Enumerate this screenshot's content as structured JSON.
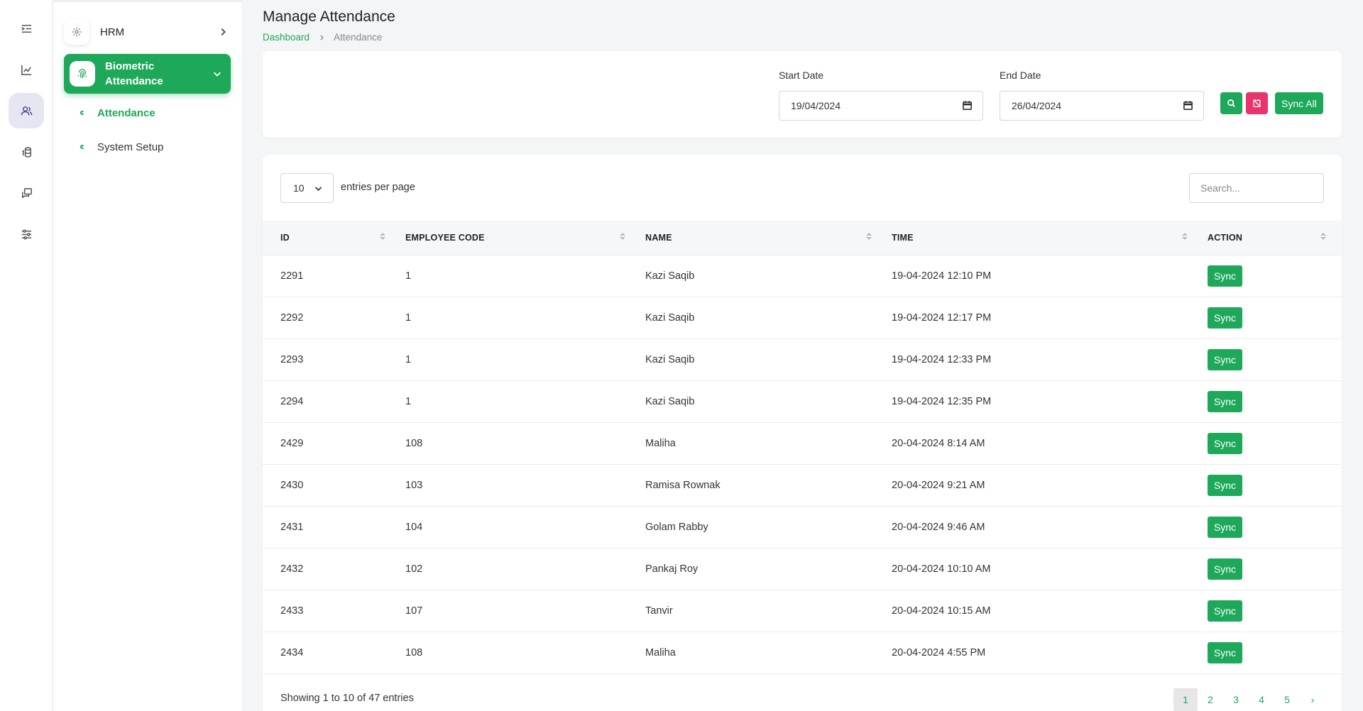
{
  "nav": {
    "hrm_label": "HRM",
    "biometric_label": "Biometric Attendance",
    "sub_items": [
      {
        "label": "Attendance",
        "active": true
      },
      {
        "label": "System Setup",
        "active": false
      }
    ]
  },
  "header": {
    "title": "Manage Attendance",
    "breadcrumb": [
      "Dashboard",
      "Attendance"
    ]
  },
  "filter": {
    "start_label": "Start Date",
    "start_value": "19/04/2024",
    "end_label": "End Date",
    "end_value": "26/04/2024",
    "sync_all_label": "Sync All"
  },
  "table": {
    "per_page_value": "10",
    "per_page_text": "entries per page",
    "search_placeholder": "Search...",
    "columns": [
      "ID",
      "EMPLOYEE CODE",
      "NAME",
      "TIME",
      "ACTION"
    ],
    "rows": [
      {
        "id": "2291",
        "code": "1",
        "name": "Kazi Saqib",
        "time": "19-04-2024 12:10 PM",
        "action": "Sync"
      },
      {
        "id": "2292",
        "code": "1",
        "name": "Kazi Saqib",
        "time": "19-04-2024 12:17 PM",
        "action": "Sync"
      },
      {
        "id": "2293",
        "code": "1",
        "name": "Kazi Saqib",
        "time": "19-04-2024 12:33 PM",
        "action": "Sync"
      },
      {
        "id": "2294",
        "code": "1",
        "name": "Kazi Saqib",
        "time": "19-04-2024 12:35 PM",
        "action": "Sync"
      },
      {
        "id": "2429",
        "code": "108",
        "name": "Maliha",
        "time": "20-04-2024 8:14 AM",
        "action": "Sync"
      },
      {
        "id": "2430",
        "code": "103",
        "name": "Ramisa Rownak",
        "time": "20-04-2024 9:21 AM",
        "action": "Sync"
      },
      {
        "id": "2431",
        "code": "104",
        "name": "Golam Rabby",
        "time": "20-04-2024 9:46 AM",
        "action": "Sync"
      },
      {
        "id": "2432",
        "code": "102",
        "name": "Pankaj Roy",
        "time": "20-04-2024 10:10 AM",
        "action": "Sync"
      },
      {
        "id": "2433",
        "code": "107",
        "name": "Tanvir",
        "time": "20-04-2024 10:15 AM",
        "action": "Sync"
      },
      {
        "id": "2434",
        "code": "108",
        "name": "Maliha",
        "time": "20-04-2024 4:55 PM",
        "action": "Sync"
      }
    ],
    "showing_text": "Showing 1 to 10 of 47 entries",
    "pages": [
      "1",
      "2",
      "3",
      "4",
      "5"
    ],
    "current_page": "1",
    "next_symbol": "›"
  },
  "colors": {
    "accent": "#1ea85a",
    "danger": "#e8336b",
    "rail_active": "#e6e6f3"
  }
}
